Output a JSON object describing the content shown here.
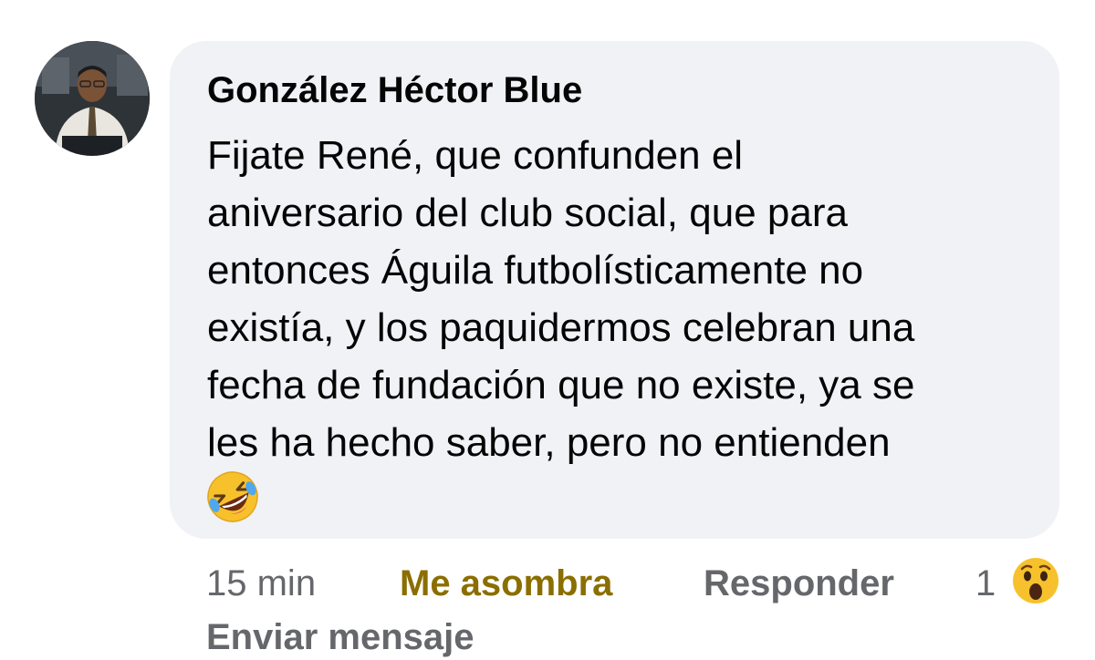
{
  "comment": {
    "author": "González Héctor Blue",
    "lines": [
      "Fijate René, que confunden el",
      "aniversario del club social, que para",
      "entonces Águila futbolísticamente no",
      "existía, y los paquidermos celebran una",
      "fecha de fundación que no existe, ya se",
      "les ha hecho saber, pero no entienden"
    ],
    "trailing_emoji": "rolling-on-floor-laughing-icon",
    "avatar": "profile-photo"
  },
  "actions": {
    "time": "15 min",
    "reaction_label": "Me asombra",
    "reply_label": "Responder",
    "reaction_count": "1",
    "reaction_icon": "wow-face-icon",
    "send_message_label": "Enviar mensaje"
  },
  "colors": {
    "bubble": "#f0f2f5",
    "reaction_active": "#8b6e00",
    "secondary_text": "#65676b"
  }
}
